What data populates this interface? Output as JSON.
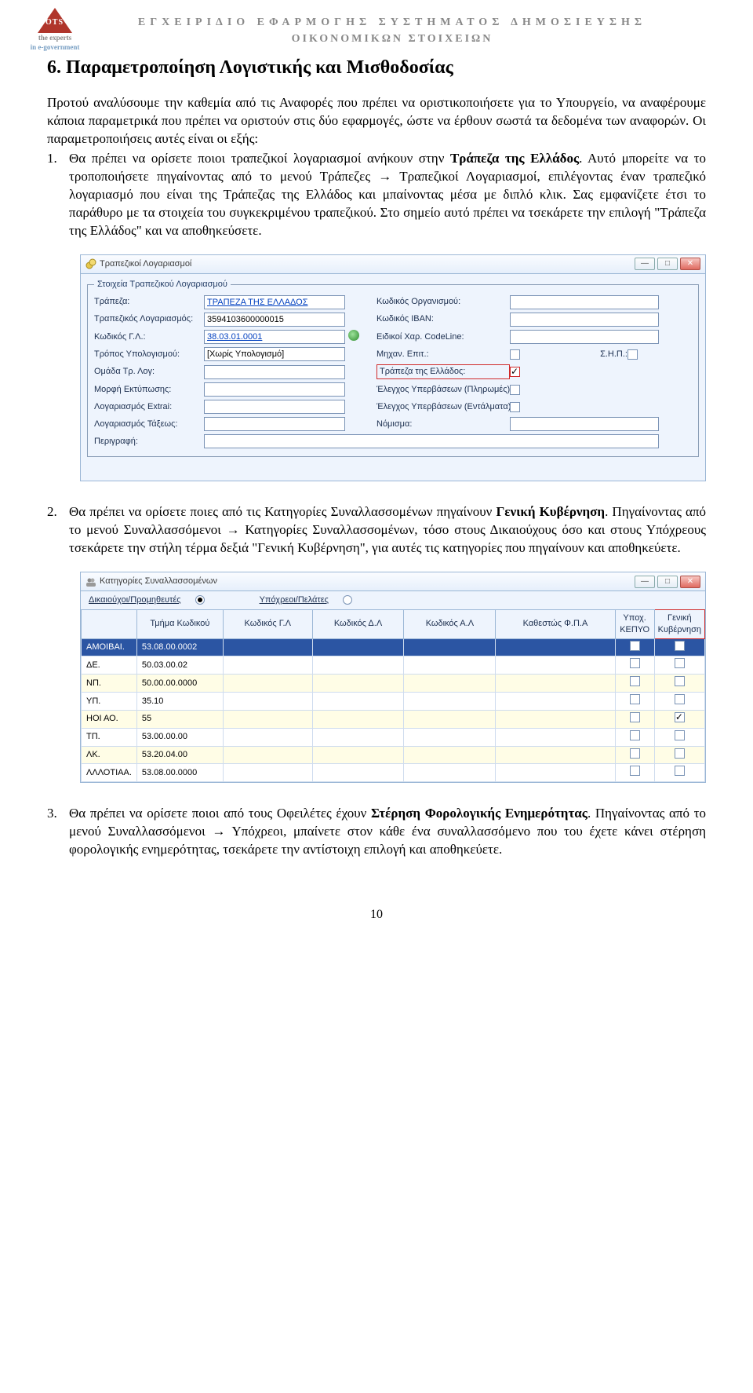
{
  "header": {
    "line1": "ΕΓΧΕΙΡΙΔΙΟ ΕΦΑΡΜΟΓΗΣ ΣΥΣΤΗΜΑΤΟΣ ΔΗΜΟΣΙΕΥΣΗΣ",
    "line2": "ΟΙΚΟΝΟΜΙΚΩΝ ΣΤΟΙΧΕΙΩΝ",
    "logo_tag1": "the experts",
    "logo_tag2": "in e-government"
  },
  "title": "6. Παραμετροποίηση Λογιστικής και Μισθοδοσίας",
  "intro": "Προτού αναλύσουμε την καθεμία από τις Αναφορές που πρέπει να οριστικοποιήσετε για το Υπουργείο, να αναφέρουμε κάποια παραμετρικά που πρέπει να οριστούν στις δύο εφαρμογές, ώστε να έρθουν σωστά τα δεδομένα των αναφορών. Οι παραμετροποιήσεις αυτές είναι οι εξής:",
  "item1": {
    "num": "1.",
    "lead": "Θα πρέπει να ορίσετε ποιοι τραπεζικοί λογαριασμοί ανήκουν στην ",
    "bold1": "Τράπεζα της Ελλάδος",
    "rest": ". Αυτό μπορείτε να το τροποποιήσετε πηγαίνοντας από το μενού Τράπεζες → Τραπεζικοί Λογαριασμοί, επιλέγοντας έναν τραπεζικό λογαριασμό που είναι της Τράπεζας της Ελλάδος και μπαίνοντας μέσα με διπλό κλικ. Σας εμφανίζετε έτσι το παράθυρο με τα στοιχεία του συγκεκριμένου τραπεζικού. Στο σημείο αυτό πρέπει να τσεκάρετε την επιλογή \"Τράπεζα της Ελλάδος\" και να αποθηκεύσετε."
  },
  "win1": {
    "title": "Τραπεζικοί Λογαριασμοί",
    "legend": "Στοιχεία Τραπεζικού Λογαριασμού",
    "labels": {
      "trapeza": "Τράπεζα:",
      "log": "Τραπεζικός Λογαριασμός:",
      "kgl": "Κωδικός Γ.Λ.:",
      "tropos": "Τρόπος Υπολογισμού:",
      "omada": "Ομάδα Τρ. Λογ:",
      "morfi": "Μορφή Εκτύπωσης:",
      "extrai": "Λογαριασμός Extrai:",
      "taxeos": "Λογαριασμός Τάξεως:",
      "perigrafi": "Περιγραφή:",
      "korg": "Κωδικός Οργανισμού:",
      "iban": "Κωδικός IBAN:",
      "codeline": "Ειδικοί Χαρ. CodeLine:",
      "mixan": "Μηχαν. Επιτ.:",
      "shp": "Σ.Η.Π.:",
      "tte": "Τράπεζα της Ελλάδος:",
      "eplir": "Έλεγχος Υπερβάσεων (Πληρωμές):",
      "eent": "Έλεγχος Υπερβάσεων (Εντάλματα):",
      "nomisma": "Νόμισμα:"
    },
    "values": {
      "trapeza": "ΤΡΑΠΕΖΑ ΤΗΣ ΕΛΛΑΔΟΣ",
      "log": "3594103600000015",
      "kgl": "38.03.01.0001",
      "tropos": "[Χωρίς Υπολογισμό]"
    }
  },
  "item2": {
    "num": "2.",
    "lead": "Θα πρέπει να ορίσετε ποιες από τις Κατηγορίες Συναλλασσομένων πηγαίνουν ",
    "bold1": "Γενική Κυβέρνηση",
    "rest": ". Πηγαίνοντας από το μενού Συναλλασσόμενοι → Κατηγορίες Συναλλασσομένων, τόσο στους Δικαιούχους όσο και στους Υπόχρεους τσεκάρετε την στήλη τέρμα δεξιά \"Γενική Κυβέρνηση\", για αυτές τις κατηγορίες που πηγαίνουν και αποθηκεύετε."
  },
  "win2": {
    "title": "Κατηγορίες Συναλλασσομένων",
    "radio1": "Δικαιούχοι/Προμηθευτές",
    "radio2": "Υπόχρεοι/Πελάτες",
    "cols": [
      "",
      "Τμήμα Κωδικού",
      "Κωδικός Γ.Λ",
      "Κωδικός Δ.Λ",
      "Κωδικός Α.Λ",
      "Καθεστώς Φ.Π.Α",
      "Υποχ. ΚΕΠΥΟ",
      "Γενική Κυβέρνηση"
    ],
    "rows": [
      {
        "c0": "ΑΜΟΙΒΑΙ.",
        "c1": "53.08.00.0002",
        "sel": true
      },
      {
        "c0": "ΔΕ.",
        "c1": "50.03.00.02"
      },
      {
        "c0": "ΝΠ.",
        "c1": "50.00.00.0000"
      },
      {
        "c0": "ΥΠ.",
        "c1": "35.10"
      },
      {
        "c0marg": "ΗΟΙ",
        "c0": "ΑΟ.",
        "c1": "55",
        "gk": true
      },
      {
        "c0": "ΤΠ.",
        "c1": "53.00.00.00"
      },
      {
        "c0": "ΛΚ.",
        "c1": "53.20.04.00"
      },
      {
        "c0marg": "ΛΛΛΟΤΙΑΑ.",
        "c0": "",
        "c1": "53.08.00.0000"
      }
    ]
  },
  "item3": {
    "num": "3.",
    "lead": "Θα πρέπει να ορίσετε ποιοι από τους Οφειλέτες έχουν ",
    "bold1": "Στέρηση Φορολογικής Ενημερότητας",
    "rest": ". Πηγαίνοντας από το μενού Συναλλασσόμενοι → Υπόχρεοι, μπαίνετε στον κάθε ένα συναλλασσόμενο που του έχετε κάνει στέρηση φορολογικής ενημερότητας, τσεκάρετε την αντίστοιχη επιλογή και αποθηκεύετε."
  },
  "page_number": "10"
}
